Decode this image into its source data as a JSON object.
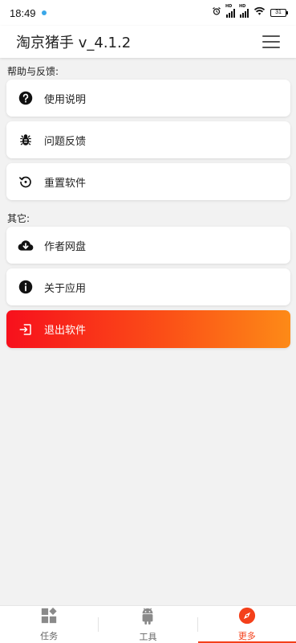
{
  "status_bar": {
    "time": "18:49",
    "battery": "31"
  },
  "app_bar": {
    "title": "淘京猪手 v_4.1.2"
  },
  "sections": [
    {
      "label": "帮助与反馈:",
      "items": [
        {
          "label": "使用说明",
          "icon": "question-icon"
        },
        {
          "label": "问题反馈",
          "icon": "bug-icon"
        },
        {
          "label": "重置软件",
          "icon": "reset-icon"
        }
      ]
    },
    {
      "label": "其它:",
      "items": [
        {
          "label": "作者网盘",
          "icon": "cloud-download-icon"
        },
        {
          "label": "关于应用",
          "icon": "info-icon"
        }
      ]
    }
  ],
  "exit": {
    "label": "退出软件",
    "icon": "exit-icon"
  },
  "bottom_nav": [
    {
      "label": "任务",
      "icon": "widgets-icon"
    },
    {
      "label": "工具",
      "icon": "android-icon"
    },
    {
      "label": "更多",
      "icon": "compass-icon",
      "active": true
    }
  ],
  "colors": {
    "accent": "#f4401a",
    "exit_gradient_start": "#f7101c",
    "exit_gradient_end": "#fd8a17",
    "background": "#f2f2f2"
  }
}
